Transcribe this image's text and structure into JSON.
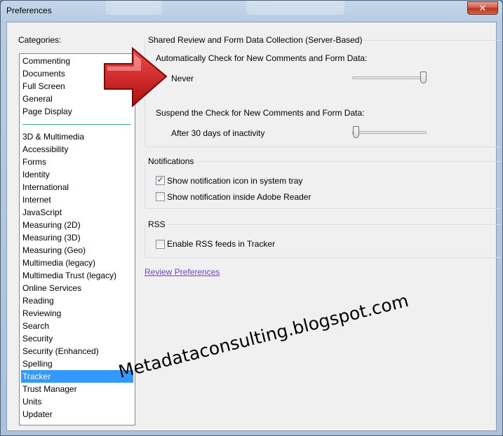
{
  "window": {
    "title": "Preferences",
    "close_glyph": "✕"
  },
  "categories": {
    "label": "Categories:",
    "group1": [
      "Commenting",
      "Documents",
      "Full Screen",
      "General",
      "Page Display"
    ],
    "group2": [
      "3D & Multimedia",
      "Accessibility",
      "Forms",
      "Identity",
      "International",
      "Internet",
      "JavaScript",
      "Measuring (2D)",
      "Measuring (3D)",
      "Measuring (Geo)",
      "Multimedia (legacy)",
      "Multimedia Trust (legacy)",
      "Online Services",
      "Reading",
      "Reviewing",
      "Search",
      "Security",
      "Security (Enhanced)",
      "Spelling",
      "Tracker",
      "Trust Manager",
      "Units",
      "Updater"
    ],
    "selected": "Tracker"
  },
  "shared_review": {
    "title": "Shared Review and Form Data Collection (Server-Based)",
    "auto_check_label": "Automatically Check for New Comments and Form Data:",
    "auto_check_value": "Never",
    "auto_check_level": 1.0,
    "suspend_label": "Suspend the Check for New Comments and Form Data:",
    "suspend_value": "After 30 days of inactivity",
    "suspend_level": 0.0
  },
  "notifications": {
    "title": "Notifications",
    "show_tray_label": "Show notification icon in system tray",
    "show_tray_checked": true,
    "show_reader_label": "Show notification inside Adobe Reader",
    "show_reader_checked": false
  },
  "rss": {
    "title": "RSS",
    "enable_label": "Enable RSS feeds in Tracker",
    "enable_checked": false
  },
  "review_link": "Review Preferences",
  "watermark": "Metadataconsulting.blogspot.com",
  "colors": {
    "selection": "#3399ff",
    "link": "#6b44c4",
    "arrow": "#d42424"
  }
}
